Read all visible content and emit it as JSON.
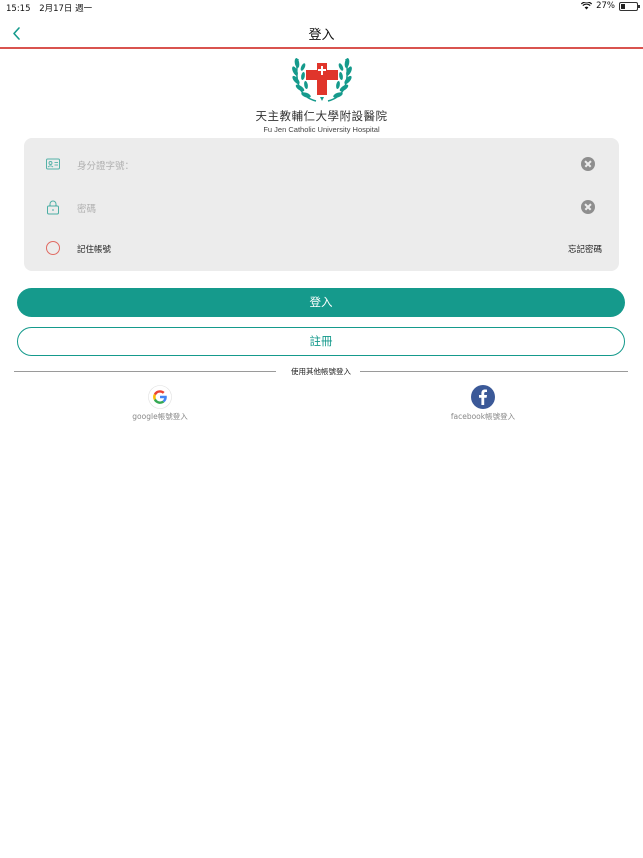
{
  "status_bar": {
    "time": "15:15",
    "date": "2月17日 週一",
    "battery": "27%",
    "battery_level": 0.27
  },
  "nav": {
    "title": "登入"
  },
  "logo": {
    "name_zh": "天主教輔仁大學附設醫院",
    "name_en": "Fu Jen Catholic University Hospital"
  },
  "form": {
    "id_placeholder": "身分證字號：",
    "password_placeholder": "密碼",
    "remember_label": "記住帳號",
    "forgot_label": "忘記密碼"
  },
  "buttons": {
    "login": "登入",
    "register": "註冊"
  },
  "other_login": {
    "divider_text": "使用其他帳號登入",
    "google_label": "google帳號登入",
    "facebook_label": "facebook帳號登入"
  },
  "colors": {
    "accent": "#159a8c",
    "nav_border": "#d9534f",
    "remember_circle": "#e06a62"
  }
}
